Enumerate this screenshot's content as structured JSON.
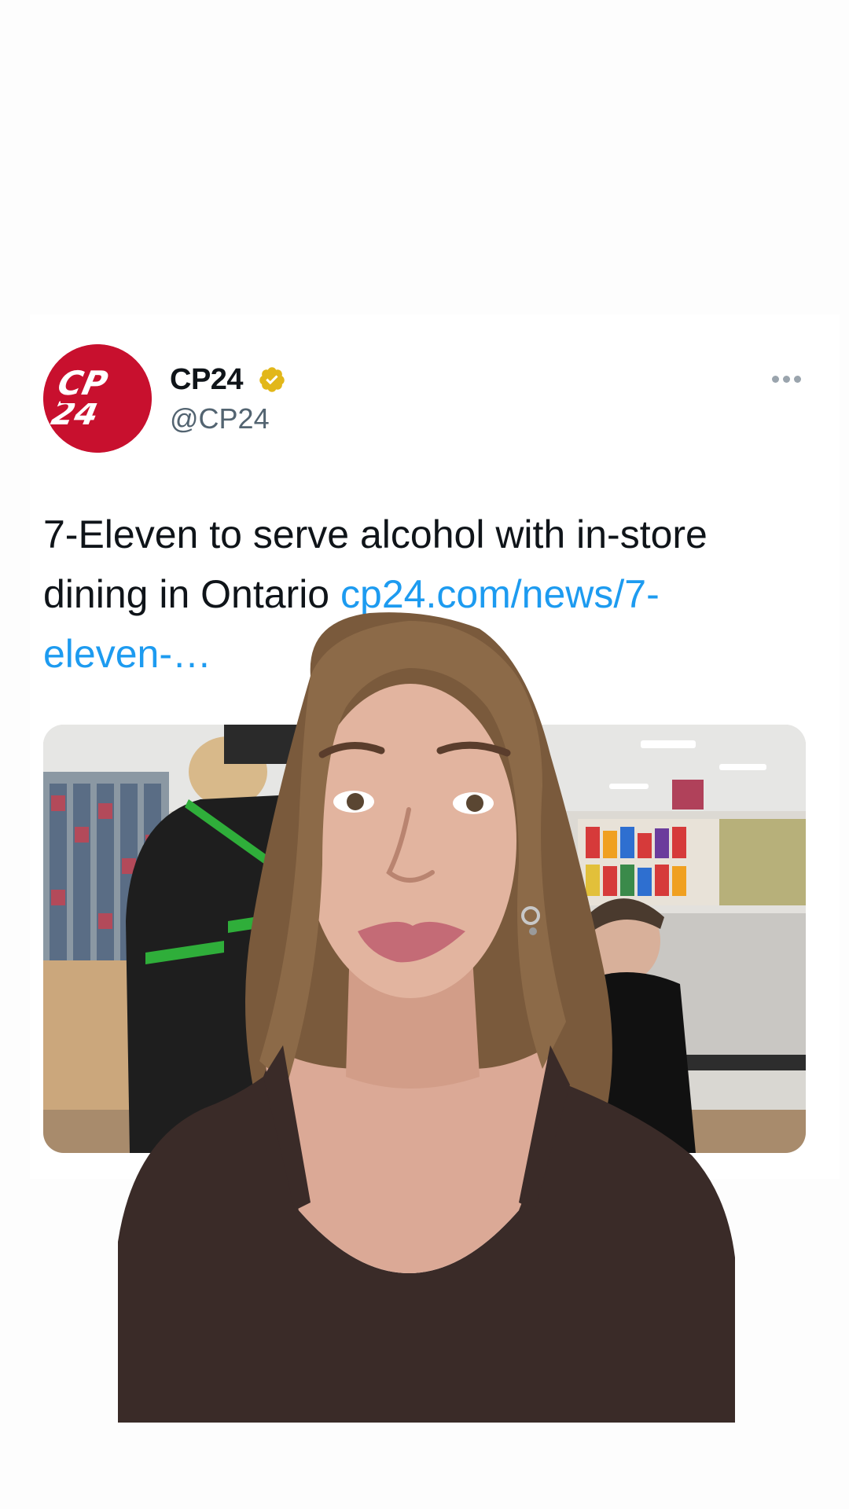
{
  "tweet": {
    "display_name": "CP24",
    "handle": "@CP24",
    "verified": true,
    "avatar_text": "CP 24",
    "text_main": "7-Eleven to serve alcohol with in-store dining in Ontario ",
    "link_text": "cp24.com/news/7-eleven-…",
    "more_icon": "more-horizontal-icon"
  },
  "colors": {
    "avatar_red": "#c8102e",
    "verified_gold": "#e2b719",
    "link_blue": "#1d9bf0",
    "text_primary": "#0f1419",
    "text_secondary": "#536471"
  }
}
